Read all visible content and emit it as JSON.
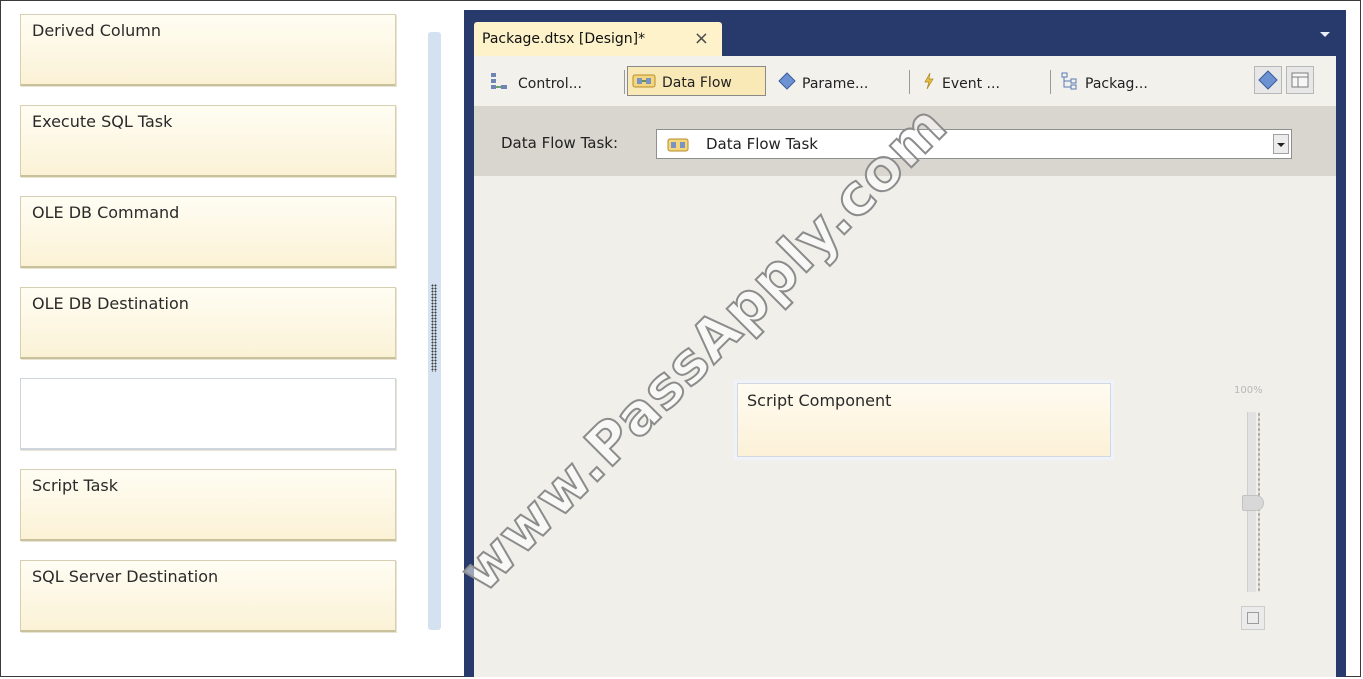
{
  "options": [
    {
      "label": "Derived Column"
    },
    {
      "label": "Execute SQL Task"
    },
    {
      "label": "OLE DB Command"
    },
    {
      "label": "OLE DB Destination"
    },
    {
      "label": ""
    },
    {
      "label": "Script Task"
    },
    {
      "label": "SQL Server Destination"
    }
  ],
  "document_tab": {
    "title": "Package.dtsx [Design]*",
    "close_glyph": "×"
  },
  "designer_tabs": [
    {
      "label": "Control...",
      "icon": "control-flow-icon"
    },
    {
      "label": "Data Flow",
      "icon": "data-flow-icon",
      "active": true
    },
    {
      "label": "Parame...",
      "icon": "parameters-icon"
    },
    {
      "label": "Event ...",
      "icon": "event-handlers-icon"
    },
    {
      "label": "Packag...",
      "icon": "package-explorer-icon"
    }
  ],
  "task_bar": {
    "label": "Data Flow Task:",
    "selected": "Data Flow Task"
  },
  "canvas": {
    "component": "Script Component",
    "zoom": "100%",
    "zoom_level_fraction": 0.5
  },
  "watermark": "www.PassApply.com",
  "colors": {
    "designer_frame": "#283a6b",
    "active_tab": "#f8e9b7",
    "card_fill": "#fbf2d6",
    "splitter": "#d4e1f1"
  }
}
